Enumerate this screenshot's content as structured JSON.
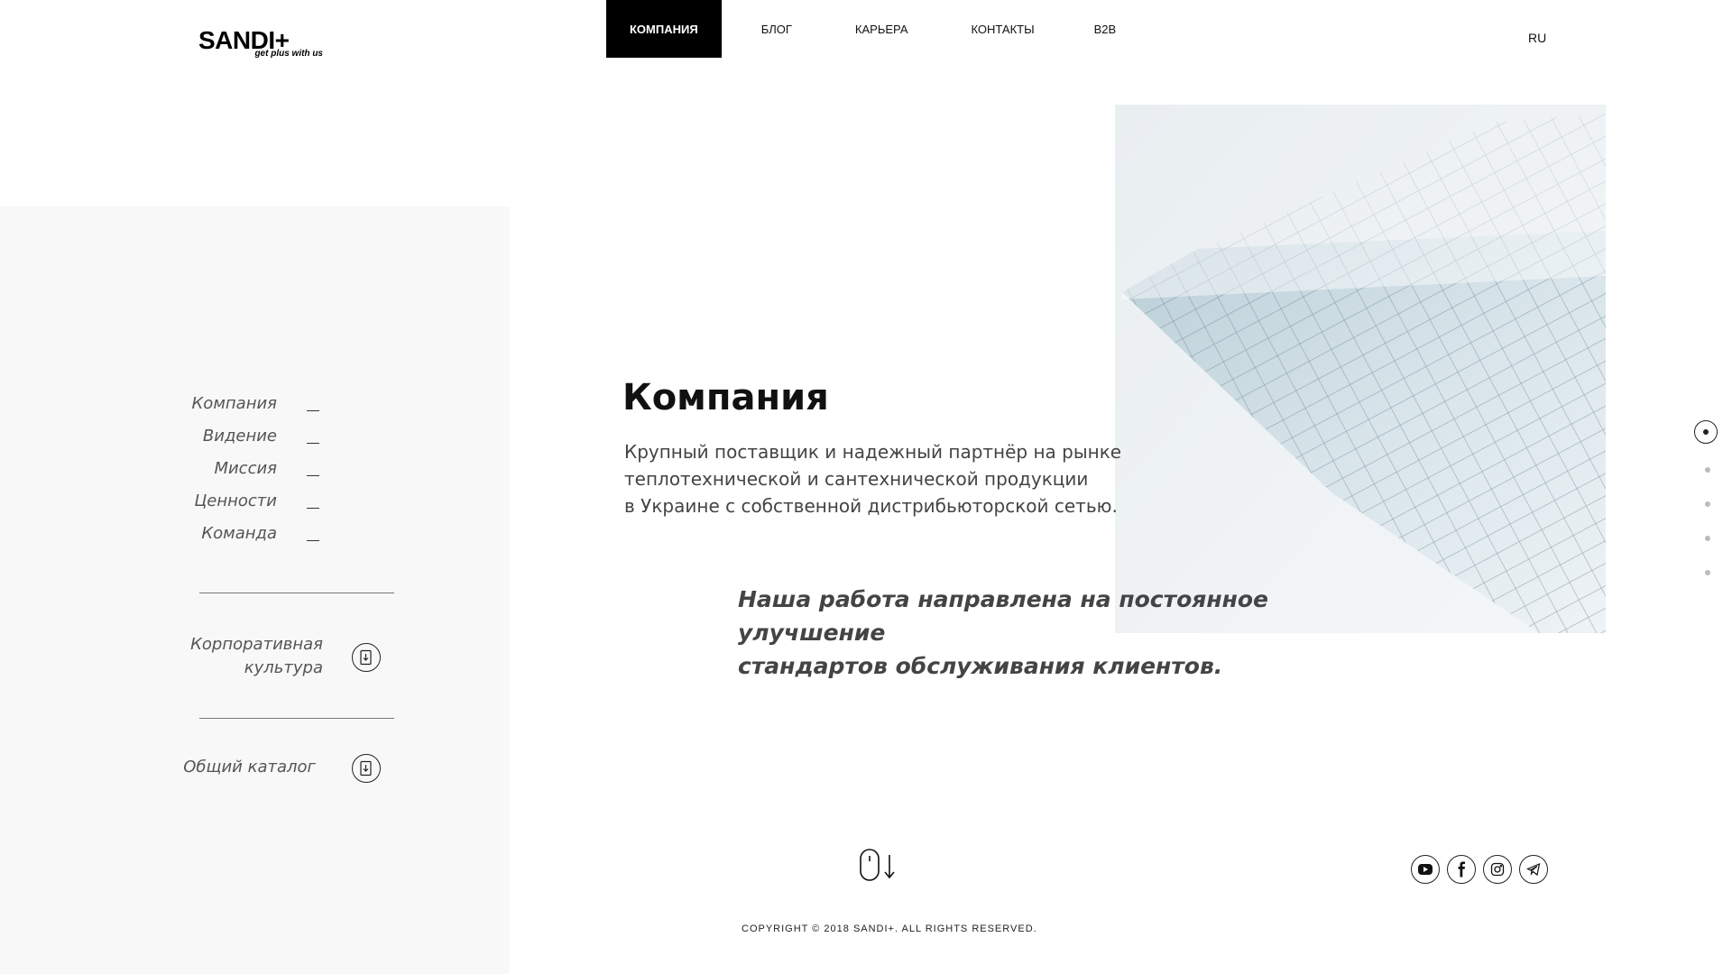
{
  "brand": {
    "name": "SANDI+",
    "tagline": "get plus with us"
  },
  "nav": {
    "items": [
      {
        "label": "КОМПАНИЯ",
        "active": true
      },
      {
        "label": "БЛОГ"
      },
      {
        "label": "КАРЬЕРА"
      },
      {
        "label": "КОНТАКТЫ"
      },
      {
        "label": "B2B"
      }
    ],
    "lang": "RU"
  },
  "sidebar": {
    "links": [
      "Компания",
      "Видение",
      "Миссия",
      "Ценности",
      "Команда"
    ],
    "downloads": [
      {
        "label_line1": "Корпоративная",
        "label_line2": "культура"
      },
      {
        "label_line1": "Общий каталог"
      }
    ]
  },
  "hero": {
    "title": "Компания",
    "description": [
      "Крупный поставщик и надежный партнёр на рынке",
      "теплотехнической и сантехнической продукции",
      "в Украине с собственной дистрибьюторской сетью."
    ],
    "quote": [
      "Наша работа направлена на постоянное улучшение",
      "стандартов обслуживания клиентов."
    ]
  },
  "pager": {
    "count": 5,
    "active_index": 0
  },
  "socials": [
    "youtube-icon",
    "facebook-icon",
    "instagram-icon",
    "telegram-icon"
  ],
  "footer": {
    "copyright": "COPYRIGHT © 2018 SANDI+. ALL RIGHTS RESERVED."
  }
}
